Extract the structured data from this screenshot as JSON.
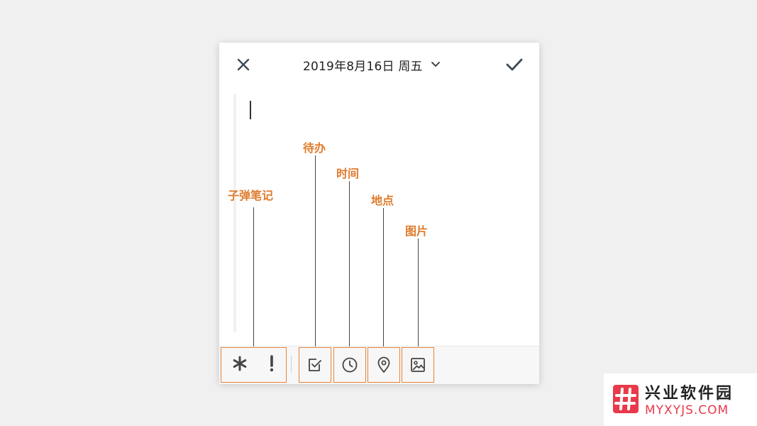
{
  "header": {
    "date_label": "2019年8月16日 周五",
    "close_icon": "close-icon",
    "confirm_icon": "check-icon",
    "dropdown_icon": "chevron-down-icon"
  },
  "toolbar": {
    "bullet_group": {
      "bullet_icon": "asterisk-icon",
      "important_icon": "exclamation-icon"
    },
    "todo_icon": "checkbox-icon",
    "time_icon": "clock-icon",
    "location_icon": "location-pin-icon",
    "image_icon": "image-icon"
  },
  "annotations": {
    "bullet_note": "子弹笔记",
    "todo": "待办",
    "time": "时间",
    "location": "地点",
    "image": "图片"
  },
  "watermark": {
    "title": "兴业软件园",
    "subtitle": "MYXYJS.COM"
  },
  "colors": {
    "accent": "#e07b2c",
    "icon": "#444444",
    "watermark_red": "#e83a4a"
  }
}
